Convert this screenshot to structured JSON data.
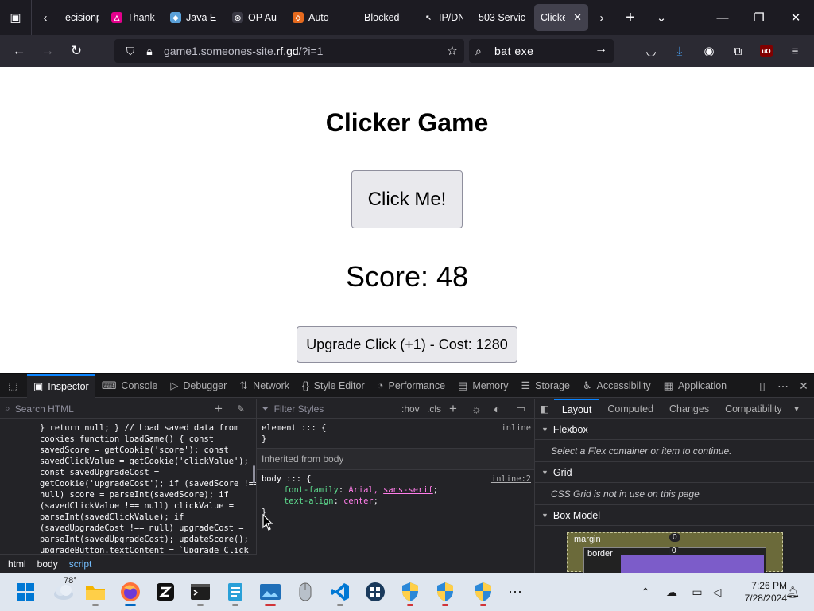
{
  "browser": {
    "tabs": [
      {
        "label": "ecisionp",
        "icon": "page-icon",
        "color": "#3a3944"
      },
      {
        "label": "Thank",
        "icon": "triangle-logo-icon",
        "color": "#e3008c"
      },
      {
        "label": "Java E",
        "icon": "cube-icon",
        "color": "#5aa0d8"
      },
      {
        "label": "OP Au",
        "icon": "globe-icon",
        "color": "#3a3944"
      },
      {
        "label": "Auto",
        "icon": "diamond-icon",
        "color": "#e66a1e"
      },
      {
        "label": "Blocked",
        "icon": "blank-icon",
        "color": "#1c1b22"
      },
      {
        "label": "IP/DN",
        "icon": "cursor-icon",
        "color": "#1c1b22"
      },
      {
        "label": "503 Servic",
        "icon": "blank-icon",
        "color": "#1c1b22"
      },
      {
        "label": "Clicker",
        "icon": "blank-icon",
        "color": "#42414d"
      }
    ],
    "active_tab_index": 8,
    "url_plain": "game1.someones-site.",
    "url_domain": "rf.gd",
    "url_path": "/?i=1",
    "search_value": "bat  exe"
  },
  "page": {
    "title": "Clicker Game",
    "click_button": "Click Me!",
    "score_text": "Score: 48",
    "upgrade_button": "Upgrade Click (+1) - Cost: 1280"
  },
  "devtools": {
    "tabs": [
      "Inspector",
      "Console",
      "Debugger",
      "Network",
      "Style Editor",
      "Performance",
      "Memory",
      "Storage",
      "Accessibility",
      "Application"
    ],
    "search_html_placeholder": "Search HTML",
    "filter_styles_placeholder": "Filter Styles",
    "hov_label": ":hov",
    "cls_label": ".cls",
    "code_lines": [
      "} return null; } // Load saved data from",
      "cookies function loadGame() { const",
      "savedScore = getCookie('score'); const",
      "savedClickValue = getCookie('clickValue');",
      "const savedUpgradeCost =",
      "getCookie('upgradeCost'); if (savedScore !==",
      "null) score = parseInt(savedScore); if",
      "(savedClickValue !== null) clickValue =",
      "parseInt(savedClickValue); if",
      "(savedUpgradeCost !== null) upgradeCost =",
      "parseInt(savedUpgradeCost); updateScore();",
      "upgradeButton.textContent = `Upgrade Click"
    ],
    "breadcrumbs": [
      "html",
      "body",
      "script"
    ],
    "element_rule": {
      "selector": "element ::: {",
      "close": "}",
      "source": "inline"
    },
    "inherited_label": "Inherited from body",
    "body_rule": {
      "selector": "body ::: {",
      "source": "inline:2",
      "font_family_prop": "font-family",
      "font_family_val1": "Arial,",
      "font_family_val2": "sans-serif",
      "text_align_prop": "text-align",
      "text_align_val": "center",
      "close": "}"
    },
    "side_tabs": [
      "Layout",
      "Computed",
      "Changes",
      "Compatibility"
    ],
    "flexbox_title": "Flexbox",
    "flexbox_msg": "Select a Flex container or item to continue.",
    "grid_title": "Grid",
    "grid_msg": "CSS Grid is not in use on this page",
    "boxmodel_title": "Box Model",
    "bm_margin_label": "margin",
    "bm_border_label": "border",
    "bm_margin_value": "0",
    "bm_border_value": "0"
  },
  "taskbar": {
    "weather_temp": "78°",
    "time": "7:26 PM",
    "date": "7/28/2024",
    "apps": [
      "start-icon",
      "weather-icon",
      "file-explorer-icon",
      "firefox-icon",
      "zed-icon",
      "terminal-icon",
      "notepad-icon",
      "photos-icon",
      "mouse-icon",
      "vscode-icon",
      "windows-admin-icon",
      "security-shield-icon",
      "security-shield-icon-2",
      "security-shield-icon-3",
      "more-apps-icon"
    ]
  }
}
